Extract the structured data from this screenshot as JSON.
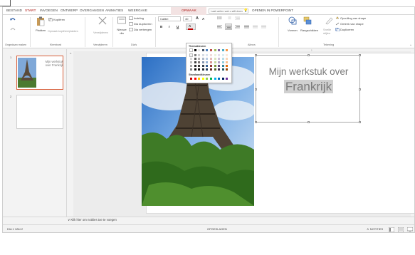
{
  "tabs": {
    "bestand": "BESTAND",
    "start": "START",
    "invoegen": "INVOEGEN",
    "ontwerp": "ONTWERP",
    "overgangen": "OVERGANGEN",
    "animaties": "ANIMATIES",
    "weergave": "WEERGAVE",
    "opmaak": "OPMAAK",
    "tell_me": "Laat weten wat u wilt doen",
    "open_in": "OPENEN IN POWERPOINT"
  },
  "ribbon": {
    "undo_group": "Ongedaan maken",
    "kopieren": "Kopiëren",
    "plakken": "Plakken",
    "opmaak_kopieren": "Opmaak kopiëren/plakken",
    "klembord": "Klembord",
    "verwijderen": "Verwijderen",
    "verwijderen_group": "Verwijderen",
    "indeling": "Indeling",
    "nieuwe_dia": "Nieuwe dia",
    "dia_dupliceren": "Dia dupliceren",
    "dia_verbergen": "Dia verbergen",
    "dias_group": "Dia's",
    "font_name": "Calibri",
    "font_size": "40",
    "grow": "A",
    "shrink": "A",
    "bold": "B",
    "italic": "I",
    "underline": "U",
    "font_color": "A",
    "alinea": "Alinea",
    "vormen": "Vormen",
    "rangschikken": "Rangschikken",
    "snelle_stijlen": "Snelle stijlen",
    "opvulling": "Opvulling van shape",
    "omtrek": "Omtrek van shape",
    "dupliceren": "Dupliceren",
    "tekening": "Tekening"
  },
  "picker": {
    "theme_colors": "Themakleuren",
    "standard_colors": "Standaardkleuren",
    "theme_rows": [
      [
        "#ffffff",
        "#000000",
        "#e8e8e8",
        "#44546a",
        "#4f81bd",
        "#c0504d",
        "#9bbb59",
        "#8064a2",
        "#4bacc6",
        "#f79646"
      ],
      [
        "#f2f2f2",
        "#7f7f7f",
        "#d0d0d0",
        "#d6dce4",
        "#dbe5f1",
        "#f2dcdb",
        "#ebf1dd",
        "#e5e0ec",
        "#dbeef3",
        "#fdeada"
      ],
      [
        "#d8d8d8",
        "#595959",
        "#aeaaaa",
        "#adb9ca",
        "#b8cce4",
        "#e5b9b7",
        "#d7e3bc",
        "#ccc1d9",
        "#b7dde8",
        "#fbd5b5"
      ],
      [
        "#bfbfbf",
        "#3f3f3f",
        "#757171",
        "#8496b0",
        "#95b3d7",
        "#d99694",
        "#c3d69b",
        "#b2a2c7",
        "#92cddc",
        "#fac08f"
      ],
      [
        "#a5a5a5",
        "#262626",
        "#3a3838",
        "#323f4f",
        "#366092",
        "#953734",
        "#76923c",
        "#5f497a",
        "#31859b",
        "#e36c09"
      ],
      [
        "#7f7f7f",
        "#0c0c0c",
        "#171616",
        "#222a35",
        "#244061",
        "#632423",
        "#4f6128",
        "#3f3151",
        "#205867",
        "#974806"
      ]
    ],
    "standard_row": [
      "#c00000",
      "#ff0000",
      "#ffc000",
      "#ffff00",
      "#92d050",
      "#00b050",
      "#00b0f0",
      "#0070c0",
      "#002060",
      "#7030a0"
    ]
  },
  "thumbs": {
    "n1": "1",
    "n2": "2",
    "t1_line1": "Mijn werkstuk",
    "t1_line2": "over Frankrijk"
  },
  "slide": {
    "title": "Mijn werkstuk over",
    "subtitle": "Frankrijk"
  },
  "notes": {
    "label": "Klik hier om notities toe te voegen"
  },
  "status": {
    "dia": "DIA 1 VAN 2",
    "opgeslagen": "OPGESLAGEN",
    "notities": "NOTITIES"
  },
  "colors": {
    "accent": "#c0504d",
    "selected_text_bg": "#d0d0d0",
    "title_text": "#7a7a7a"
  }
}
